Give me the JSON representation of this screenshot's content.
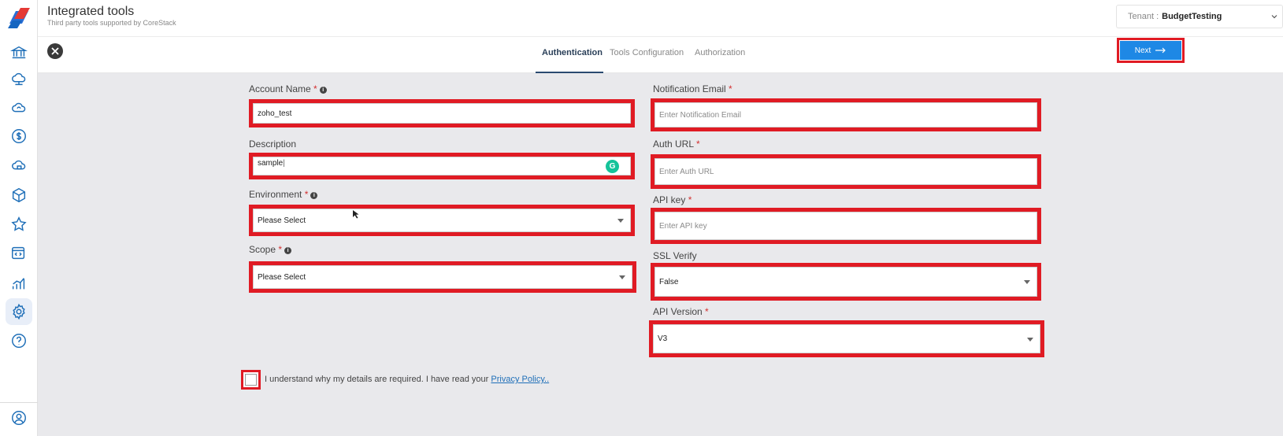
{
  "header": {
    "title": "Integrated tools",
    "subtitle": "Third party tools supported by CoreStack",
    "tenant_label": "Tenant :",
    "tenant_value": "BudgetTesting"
  },
  "tabs": [
    {
      "label": "Authentication",
      "active": true
    },
    {
      "label": "Tools Configuration",
      "active": false
    },
    {
      "label": "Authorization",
      "active": false
    }
  ],
  "next_label": "Next",
  "sidebar": {
    "icons": [
      "bank-icon",
      "cloud-network-icon",
      "cloud-sync-icon",
      "dollar-icon",
      "cloud-lock-icon",
      "cube-icon",
      "star-icon",
      "code-settings-icon",
      "chart-icon",
      "settings-icon",
      "help-icon",
      "user-icon"
    ],
    "active": "settings-icon"
  },
  "form": {
    "account_name": {
      "label": "Account Name",
      "required": "*",
      "value": "zoho_test"
    },
    "description": {
      "label": "Description",
      "value": "sample"
    },
    "environment": {
      "label": "Environment",
      "required": "*",
      "value": "Please Select"
    },
    "scope": {
      "label": "Scope",
      "required": "*",
      "value": "Please Select"
    },
    "notification_email": {
      "label": "Notification Email",
      "required": "*",
      "placeholder": "Enter Notification Email"
    },
    "auth_url": {
      "label": "Auth URL",
      "required": "*",
      "placeholder": "Enter Auth URL"
    },
    "api_key": {
      "label": "API key",
      "required": "*",
      "placeholder": "Enter API key"
    },
    "ssl_verify": {
      "label": "SSL Verify",
      "value": "False"
    },
    "api_version": {
      "label": "API Version",
      "required": "*",
      "value": "V3"
    }
  },
  "consent": {
    "text": "I understand why my details are required. I have read your",
    "link": "Privacy Policy.."
  },
  "colors": {
    "highlight": "#e01b24",
    "primary": "#1e88e5",
    "sidebar_icon": "#1f6fb8"
  }
}
